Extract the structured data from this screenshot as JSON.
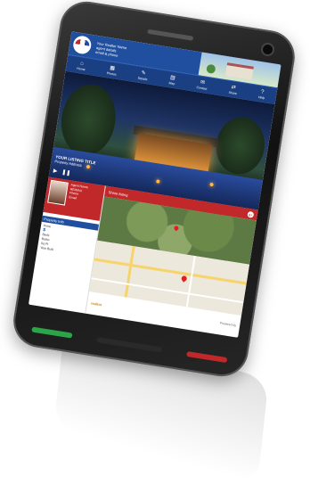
{
  "header": {
    "logo_text": "RE/MAX",
    "agent_lines": [
      "Your Realtor Name",
      "agent details",
      "email & phone"
    ]
  },
  "nav": {
    "items": [
      {
        "icon": "⌂",
        "label": "Home"
      },
      {
        "icon": "▦",
        "label": "Photos"
      },
      {
        "icon": "✎",
        "label": "Details"
      },
      {
        "icon": "▤",
        "label": "Map"
      },
      {
        "icon": "✉",
        "label": "Contact"
      },
      {
        "icon": "⇄",
        "label": "Share"
      },
      {
        "icon": "?",
        "label": "Help"
      }
    ]
  },
  "hero": {
    "title": "YOUR LISTING TITLE",
    "subtitle": "Property Address",
    "play_icon": "▶",
    "pause_icon": "❚❚"
  },
  "agent": {
    "name": "Agent Name",
    "lines": [
      "RE/MAX",
      "Phone",
      "Email"
    ]
  },
  "property": {
    "heading": "Property Info",
    "price_label": "Price",
    "price_value": "$",
    "rows": [
      "Beds",
      "Baths",
      "Sq Ft",
      "Year Built"
    ]
  },
  "share": {
    "label": "Share listing",
    "gplus": "g+"
  },
  "footer": {
    "brand": "realtor",
    "note": "Powered by"
  },
  "colors": {
    "brand_blue": "#1f4f9e",
    "brand_red": "#c0282a"
  }
}
